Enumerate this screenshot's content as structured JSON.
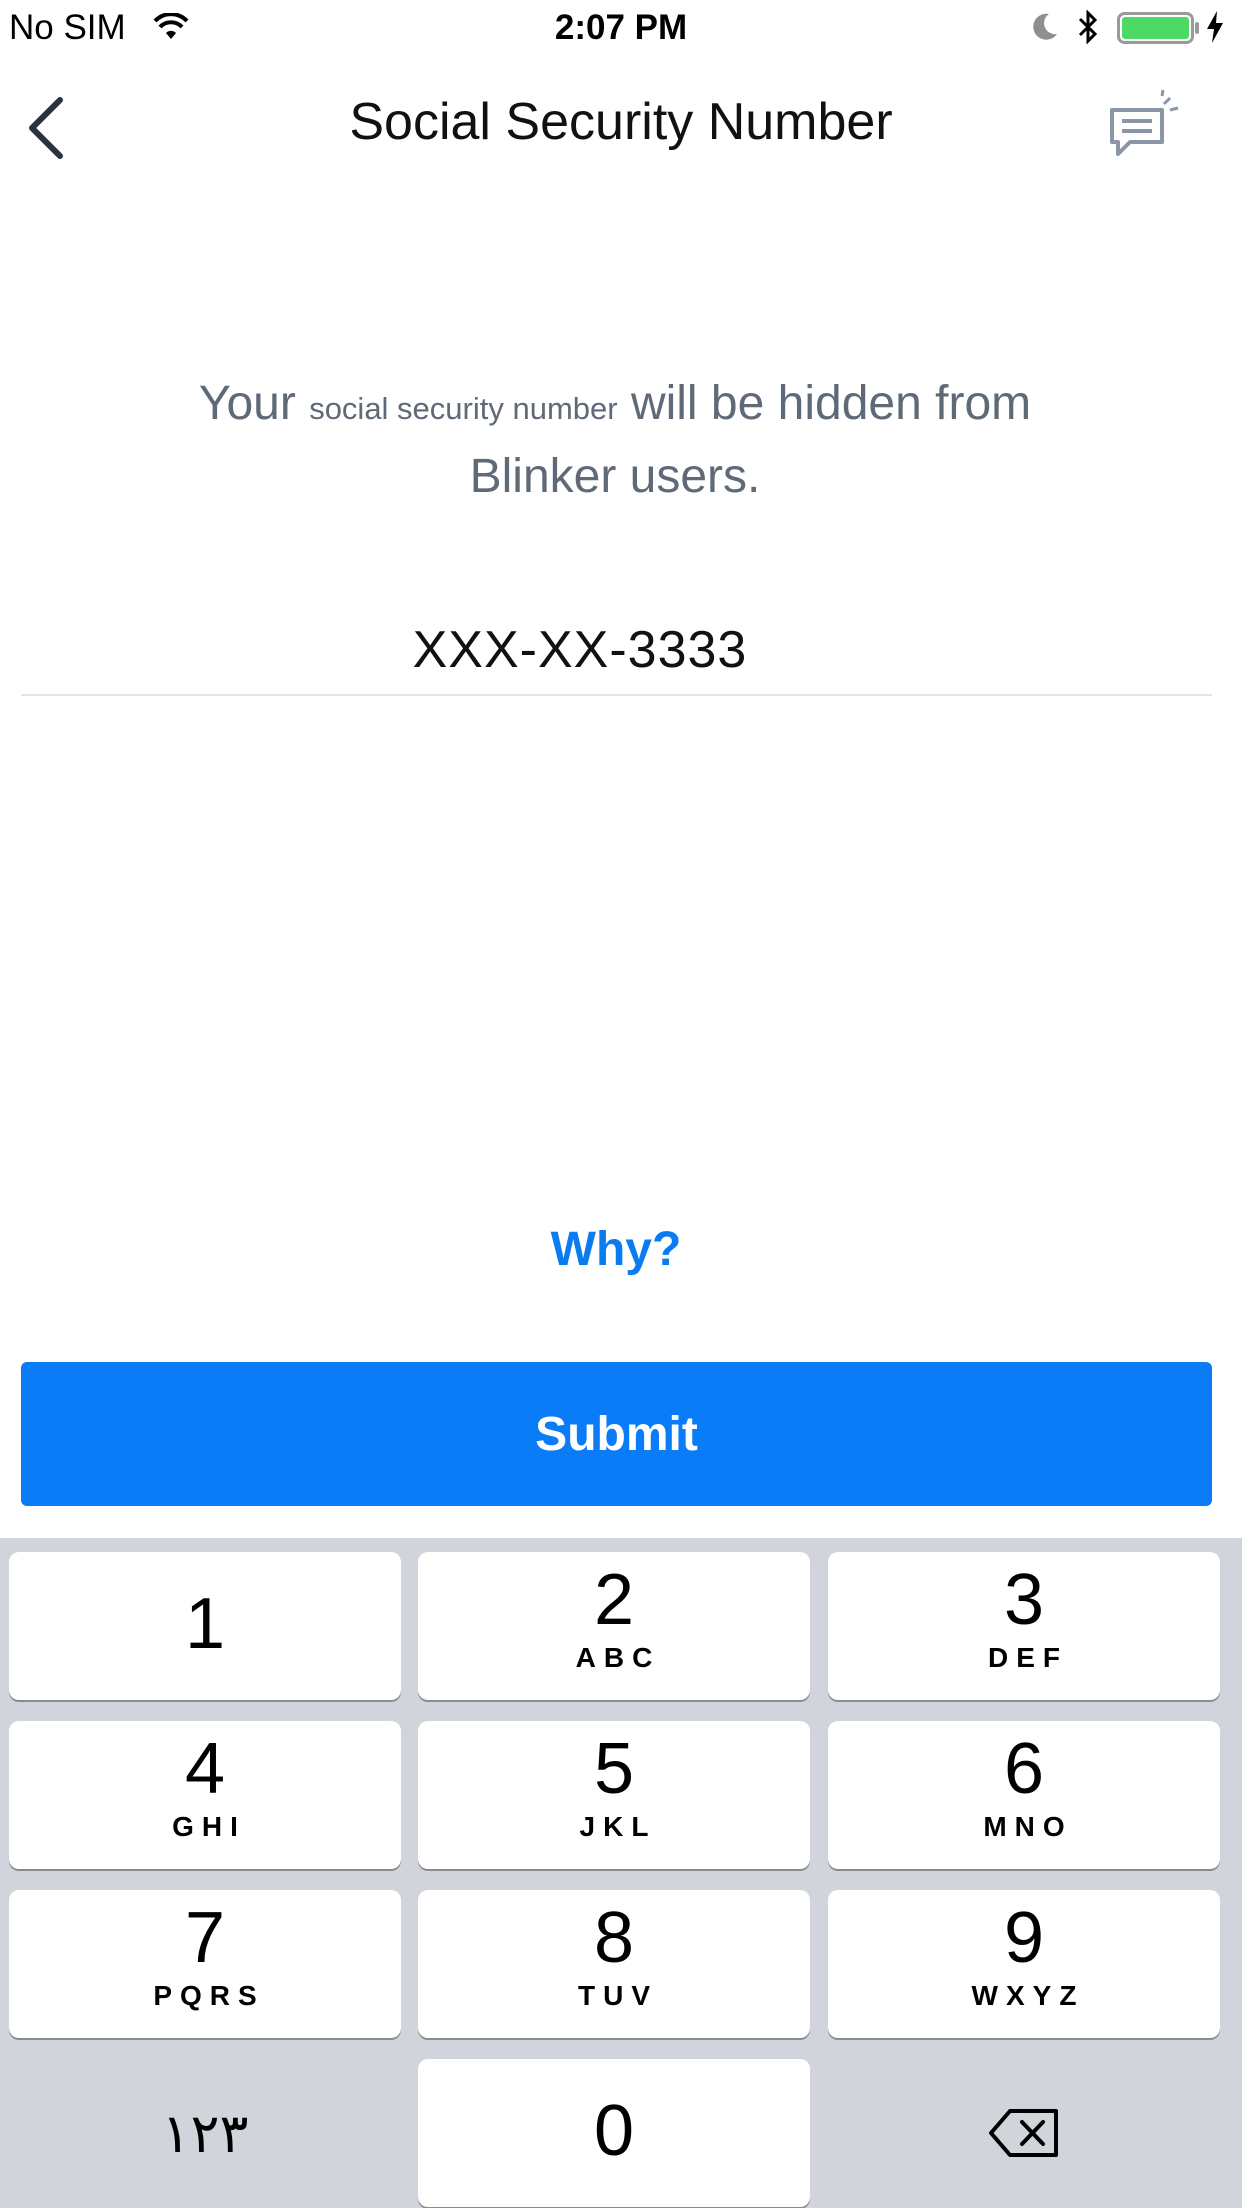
{
  "status_bar": {
    "carrier": "No SIM",
    "time": "2:07 PM",
    "icons": [
      "wifi-icon",
      "moon-icon",
      "bluetooth-icon",
      "battery-icon",
      "charging-icon"
    ],
    "battery_color": "#4cd964"
  },
  "nav": {
    "title": "Social Security Number",
    "back_icon": "chevron-left-icon",
    "chat_icon": "chat-icon"
  },
  "info": {
    "part1": "Your",
    "small": "social security number",
    "part2": "will be hidden from Blinker users."
  },
  "ssn": {
    "value": "XXX-XX-3333"
  },
  "why_link": "Why?",
  "submit_label": "Submit",
  "colors": {
    "accent": "#0a7cf7",
    "info_text": "#5f6a78",
    "keyboard_bg": "#d1d5db"
  },
  "keypad": {
    "keys": [
      {
        "num": "1",
        "letters": ""
      },
      {
        "num": "2",
        "letters": "ABC"
      },
      {
        "num": "3",
        "letters": "DEF"
      },
      {
        "num": "4",
        "letters": "GHI"
      },
      {
        "num": "5",
        "letters": "JKL"
      },
      {
        "num": "6",
        "letters": "MNO"
      },
      {
        "num": "7",
        "letters": "PQRS"
      },
      {
        "num": "8",
        "letters": "TUV"
      },
      {
        "num": "9",
        "letters": "WXYZ"
      },
      {
        "num": "0",
        "letters": ""
      }
    ],
    "alt_key": "١٢٣",
    "delete_icon": "backspace-icon"
  }
}
